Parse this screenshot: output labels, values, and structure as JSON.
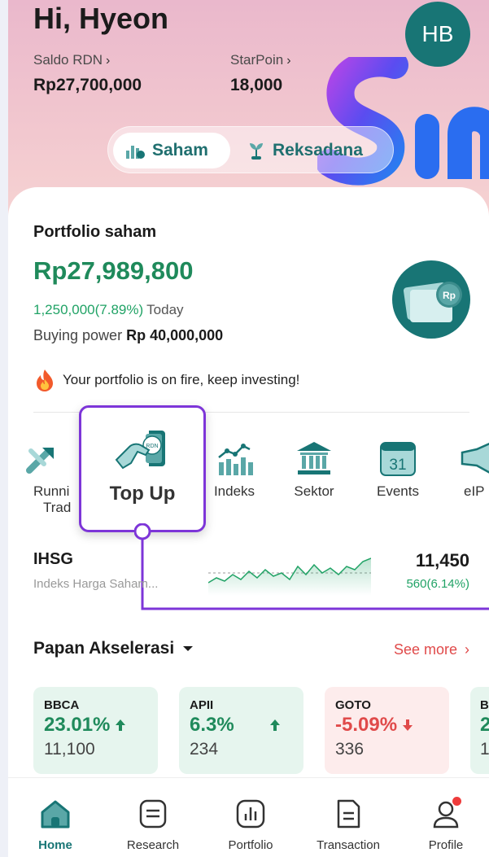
{
  "header": {
    "greeting": "Hi, Hyeon",
    "avatar_initials": "HB",
    "saldo_label": "Saldo RDN",
    "saldo_value": "Rp27,700,000",
    "starpoin_label": "StarPoin",
    "starpoin_value": "18,000"
  },
  "segment": {
    "saham_label": "Saham",
    "reksadana_label": "Reksadana"
  },
  "portfolio": {
    "title": "Portfolio saham",
    "value": "Rp27,989,800",
    "change": "1,250,000(7.89%)",
    "change_period": "Today",
    "buying_power_label": "Buying power",
    "buying_power_value": "Rp 40,000,000",
    "fire_message": "Your portfolio is on fire, keep investing!",
    "money_badge": "Rp"
  },
  "menu": {
    "running_trade_line1": "Runni",
    "running_trade_line2": "Trad",
    "topup": "Top Up",
    "topup_badge": "RDN",
    "indeks": "Indeks",
    "sektor": "Sektor",
    "events": "Events",
    "events_day": "31",
    "eipo": "eIP"
  },
  "ihsg": {
    "name": "IHSG",
    "subtitle": "Indeks Harga Saham...",
    "value": "11,450",
    "change": "560(6.14%)"
  },
  "papan": {
    "title": "Papan Akselerasi",
    "see_more": "See more",
    "stocks": [
      {
        "code": "BBCA",
        "pct": "23.01%",
        "price": "11,100",
        "direction": "up"
      },
      {
        "code": "APII",
        "pct": "6.3%",
        "price": "234",
        "direction": "up"
      },
      {
        "code": "GOTO",
        "pct": "-5.09%",
        "price": "336",
        "direction": "down"
      },
      {
        "code": "B",
        "pct": "2",
        "price": "1",
        "direction": "up"
      }
    ]
  },
  "nav": {
    "home": "Home",
    "research": "Research",
    "portfolio": "Portfolio",
    "transaction": "Transaction",
    "profile": "Profile"
  },
  "colors": {
    "brand_teal": "#187575",
    "positive": "#1f8a5b",
    "negative": "#e04a4a",
    "highlight": "#7d35d8"
  }
}
